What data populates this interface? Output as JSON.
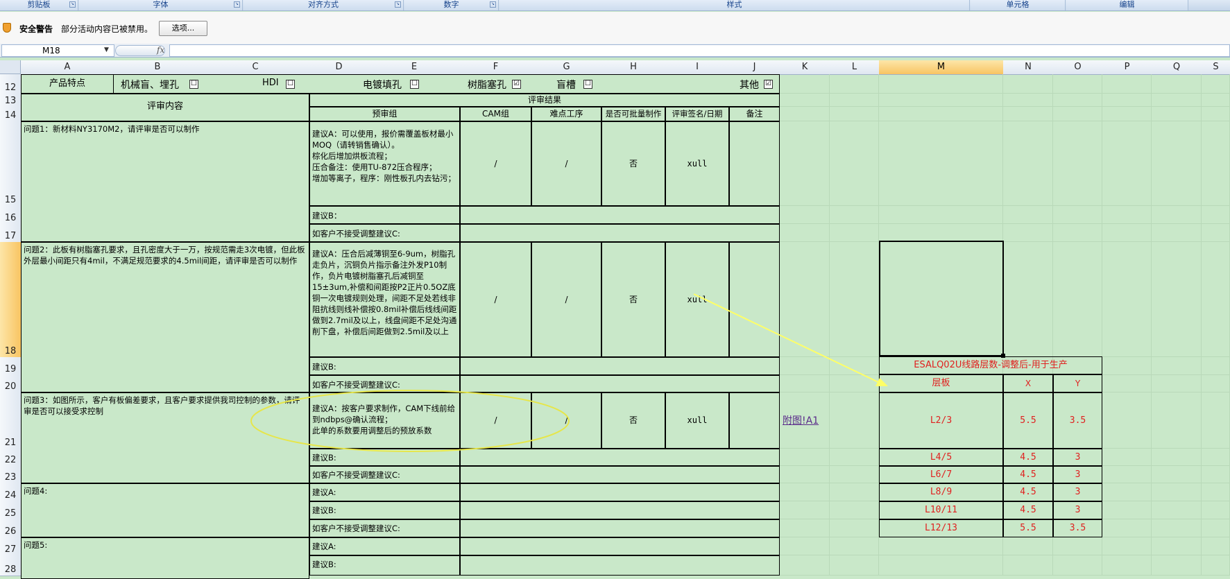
{
  "ribbon": {
    "groups": [
      "剪贴板",
      "字体",
      "对齐方式",
      "数字",
      "样式",
      "单元格",
      "编辑"
    ]
  },
  "security_bar": {
    "title": "安全警告",
    "message": "部分活动内容已被禁用。",
    "options_button": "选项..."
  },
  "formula_bar": {
    "name_box": "M18",
    "fx": "fx",
    "value": ""
  },
  "columns": [
    "A",
    "B",
    "C",
    "D",
    "E",
    "F",
    "G",
    "H",
    "I",
    "J",
    "K",
    "L",
    "M",
    "N",
    "O",
    "P",
    "Q",
    "S"
  ],
  "rows": [
    "12",
    "13",
    "14",
    "15",
    "16",
    "17",
    "18",
    "19",
    "20",
    "21",
    "22",
    "23",
    "24",
    "25",
    "26",
    "27",
    "28"
  ],
  "selected": {
    "column": "M",
    "row": "18"
  },
  "sheet": {
    "product_feature_label": "产品特点",
    "features": [
      {
        "label": "机械盲、埋孔",
        "checked": "☐"
      },
      {
        "label": "HDI",
        "checked": "☐"
      },
      {
        "label": "电镀填孔",
        "checked": "☐"
      },
      {
        "label": "树脂塞孔",
        "checked": "☑"
      },
      {
        "label": "盲槽",
        "checked": "☐"
      },
      {
        "label": "其他",
        "checked": "☑"
      }
    ],
    "review_content_header": "评审内容",
    "review_result_header": "评审结果",
    "result_columns": [
      "预审组",
      "CAM组",
      "难点工序",
      "是否可批量制作",
      "评审签名/日期",
      "备注"
    ],
    "q1": {
      "question": "问题1：新材料NY3170M2，请评审是否可以制作",
      "suggestion_a": "建议A：可以使用，报价需覆盖板材最小MOQ（请转销售确认）。\n棕化后增加烘板流程；\n压合备注：使用TU-872压合程序；\n增加等离子，程序：刚性板孔内去钻污；",
      "cam": "/",
      "difficult": "/",
      "batch": "否",
      "sign": "xull",
      "suggestion_b": "建议B：",
      "suggestion_c": "如客户不接受调整建议C:"
    },
    "q2": {
      "question": "问题2：此板有树脂塞孔要求，且孔密度大于一万，按规范需走3次电镀，但此板外层最小间距只有4mil，不满足规范要求的4.5mil间距，请评审是否可以制作",
      "suggestion_a": "建议A：压合后减薄铜至6-9um，树脂孔走负片，沉铜负片指示备注外发P10制作，负片电镀树脂塞孔后减铜至15±3um,补偿和间距按P2正片0.5OZ底铜一次电镀规则处理，间距不足处若线非阻抗线则线补偿按0.8mil补偿后线线间距做到2.7mil及以上，线盘间距不足处沟通削下盘，补偿后间距做到2.5mil及以上",
      "cam": "/",
      "difficult": "/",
      "batch": "否",
      "sign": "xull",
      "suggestion_b": "建议B:",
      "suggestion_c": "如客户不接受调整建议C:"
    },
    "q3": {
      "question": "问题3：如图所示，客户有板偏差要求，且客户要求提供我司控制的参数，请评审是否可以接受求控制",
      "suggestion_a": "建议A：按客户要求制作，CAM下线前给到ndbps@确认流程；\n此单的系数要用调整后的预放系数",
      "cam": "/",
      "difficult": "/",
      "batch": "否",
      "sign": "xull",
      "link": "附图!A1",
      "suggestion_b": "建议B:",
      "suggestion_c": "如客户不接受调整建议C:"
    },
    "q4": {
      "question": "问题4:",
      "suggestion_a": "建议A:",
      "suggestion_b": "建议B:",
      "suggestion_c": "如客户不接受调整建议C:"
    },
    "q5": {
      "question": "问题5:",
      "suggestion_a": "建议A:",
      "suggestion_b": "建议B:"
    }
  },
  "side_table": {
    "title": "ESALQ02U线路层数-调整后-用于生产",
    "headers": [
      "层板",
      "X",
      "Y"
    ],
    "rows": [
      [
        "L2/3",
        "5.5",
        "3.5"
      ],
      [
        "L4/5",
        "4.5",
        "3"
      ],
      [
        "L6/7",
        "4.5",
        "3"
      ],
      [
        "L8/9",
        "4.5",
        "3"
      ],
      [
        "L10/11",
        "4.5",
        "3"
      ],
      [
        "L12/13",
        "5.5",
        "3.5"
      ]
    ]
  },
  "colors": {
    "sheet_background": "#c9e8c9",
    "selection_header": "#f8c462",
    "annotation_ellipse": "#e6e64a",
    "annotation_arrow": "#ffff66",
    "side_table_text": "#e0201f"
  }
}
